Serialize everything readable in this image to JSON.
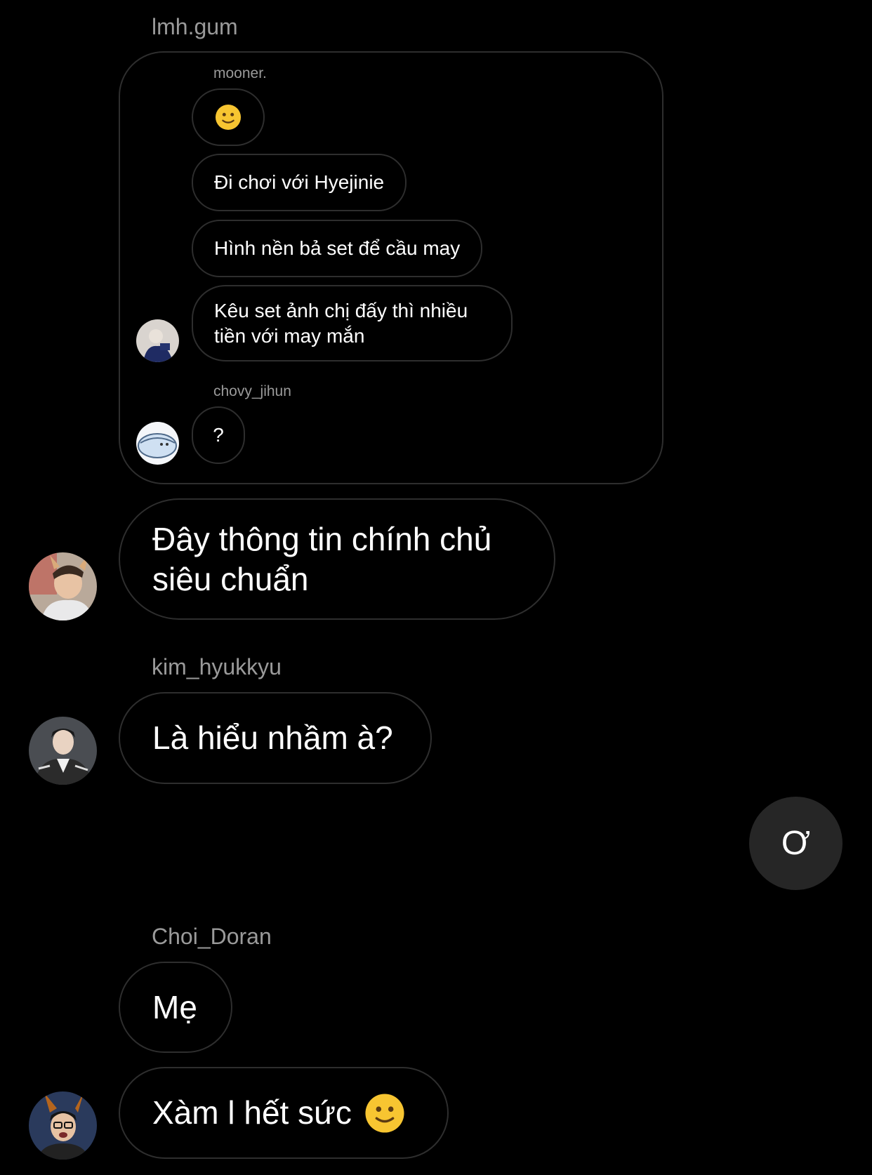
{
  "top_sender": "lmh.gum",
  "quoted_thread": {
    "sender_1": "mooner.",
    "sender_1_messages": [
      "🙂",
      "Đi chơi với Hyejinie",
      "Hình nền bả set để cầu may",
      "Kêu set ảnh chị đấy thì nhiều\ntiền với may mắn"
    ],
    "sender_2": "chovy_jihun",
    "sender_2_messages": [
      "?"
    ]
  },
  "messages": {
    "lmh_gum_reply": "Đây thông tin chính chủ\nsiêu chuẩn",
    "kim_sender": "kim_hyukkyu",
    "kim_message": "Là hiểu nhầm à?",
    "own_message": "Ơ",
    "choi_sender": "Choi_Doran",
    "choi_message_1": "Mẹ",
    "choi_message_2": "Xàm l hết sức"
  },
  "icons": {
    "slight_smile": "slightly-smiling-face-emoji"
  }
}
